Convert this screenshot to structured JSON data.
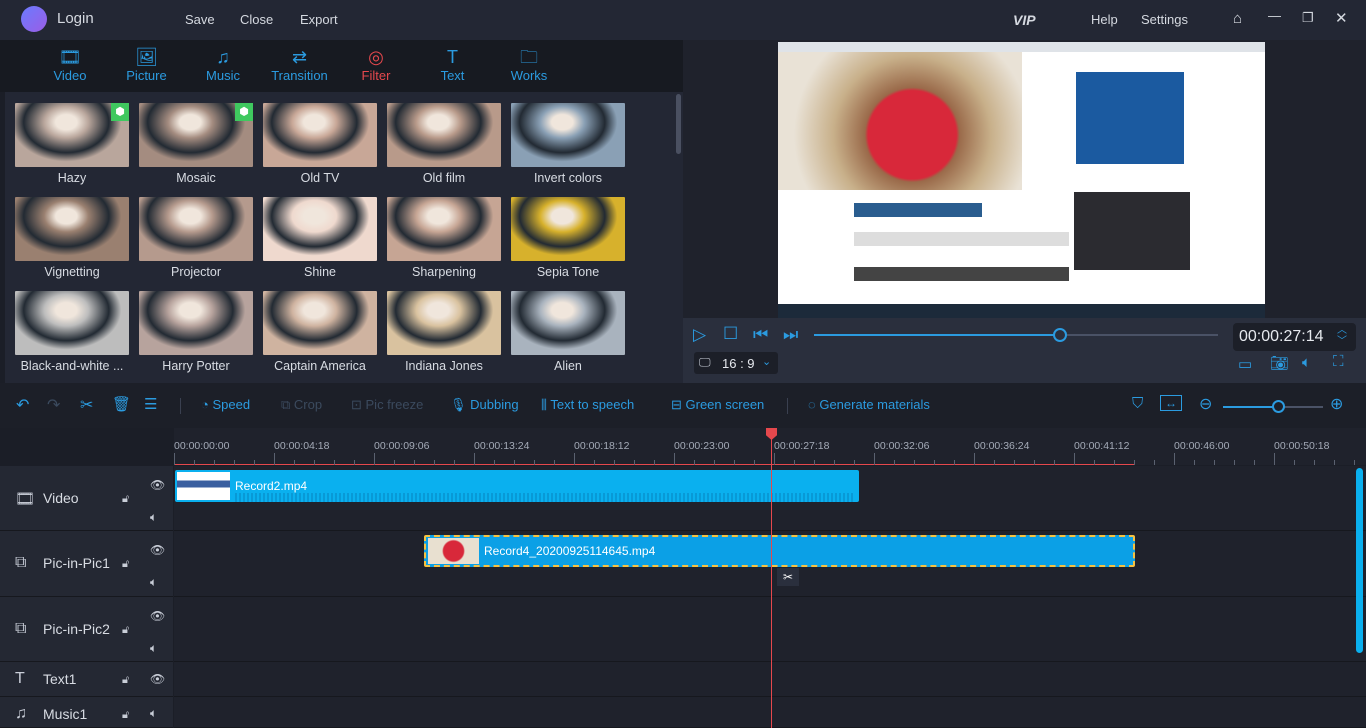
{
  "topbar": {
    "title": "Login",
    "menu": [
      "Save",
      "Close",
      "Export"
    ],
    "vip": "VIP",
    "help": "Help",
    "settings": "Settings"
  },
  "tabs": [
    {
      "label": "Video",
      "icon": "film-icon"
    },
    {
      "label": "Picture",
      "icon": "picture-icon"
    },
    {
      "label": "Music",
      "icon": "music-icon"
    },
    {
      "label": "Transition",
      "icon": "transition-icon"
    },
    {
      "label": "Filter",
      "icon": "filter-icon",
      "active": true
    },
    {
      "label": "Text",
      "icon": "text-icon"
    },
    {
      "label": "Works",
      "icon": "folder-icon"
    }
  ],
  "filters": [
    {
      "label": "Hazy",
      "vip": true,
      "color": "#b9a69c"
    },
    {
      "label": "Mosaic",
      "vip": true,
      "color": "#a48c80"
    },
    {
      "label": "Old TV",
      "color": "#c8a797"
    },
    {
      "label": "Old film",
      "color": "#b89a8a"
    },
    {
      "label": "Invert colors",
      "color": "#8aa0b5"
    },
    {
      "label": "Vignetting",
      "color": "#9a8070"
    },
    {
      "label": "Projector",
      "color": "#b59a8d"
    },
    {
      "label": "Shine",
      "color": "#efd9ce"
    },
    {
      "label": "Sharpening",
      "color": "#c6a594"
    },
    {
      "label": "Sepia Tone",
      "color": "#d7b12c"
    },
    {
      "label": "Black-and-white ...",
      "color": "#bdbdbd"
    },
    {
      "label": "Harry Potter",
      "color": "#b7a39d"
    },
    {
      "label": "Captain America",
      "color": "#cfb3a0"
    },
    {
      "label": "Indiana Jones",
      "color": "#d9c29f"
    },
    {
      "label": "Alien",
      "color": "#a9b3be"
    }
  ],
  "player": {
    "timecode": "00:00:27:14",
    "aspect": "16 : 9",
    "progress": 0.61
  },
  "toolbar": {
    "speed": "Speed",
    "crop": "Crop",
    "pic_freeze": "Pic freeze",
    "dubbing": "Dubbing",
    "tts": "Text to speech",
    "green": "Green screen",
    "generate": "Generate materials",
    "zoom_level": 0.55
  },
  "ruler": [
    "00:00:00:00",
    "00:00:04:18",
    "00:00:09:06",
    "00:00:13:24",
    "00:00:18:12",
    "00:00:23:00",
    "00:00:27:18",
    "00:00:32:06",
    "00:00:36:24",
    "00:00:41:12",
    "00:00:46:00",
    "00:00:50:18"
  ],
  "tracks": [
    {
      "name": "Video"
    },
    {
      "name": "Pic-in-Pic1"
    },
    {
      "name": "Pic-in-Pic2"
    },
    {
      "name": "Text1"
    },
    {
      "name": "Music1"
    }
  ],
  "clips": {
    "video": "Record2.mp4",
    "pip1": "Record4_20200925114645.mp4"
  },
  "colors": {
    "accent": "#2b9be0",
    "active_tab": "#e5484d",
    "clip": "#0ab0ef",
    "playhead": "#e5484d"
  }
}
